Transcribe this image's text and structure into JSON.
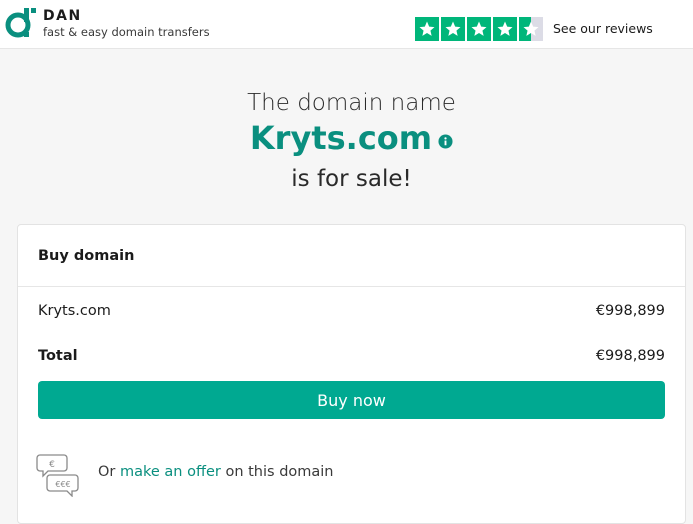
{
  "header": {
    "brand_name": "DAN",
    "tagline": "fast & easy domain transfers",
    "reviews_link": "See our reviews",
    "rating_stars": 4.5,
    "rating_color": "#00b67a"
  },
  "hero": {
    "line1": "The domain name",
    "domain": "Kryts.com",
    "line3": "is for sale!"
  },
  "card": {
    "title": "Buy domain",
    "rows": [
      {
        "label": "Kryts.com",
        "value": "€998,899"
      },
      {
        "label": "Total",
        "value": "€998,899"
      }
    ],
    "buy_button": "Buy now",
    "offer": {
      "prefix": "Or",
      "link": "make an offer",
      "suffix": "on this domain",
      "icon_labels": [
        "€",
        "€€€"
      ]
    }
  },
  "colors": {
    "accent": "#00a991",
    "domain_text": "#0a8f7f",
    "background": "#f6f6f6"
  }
}
